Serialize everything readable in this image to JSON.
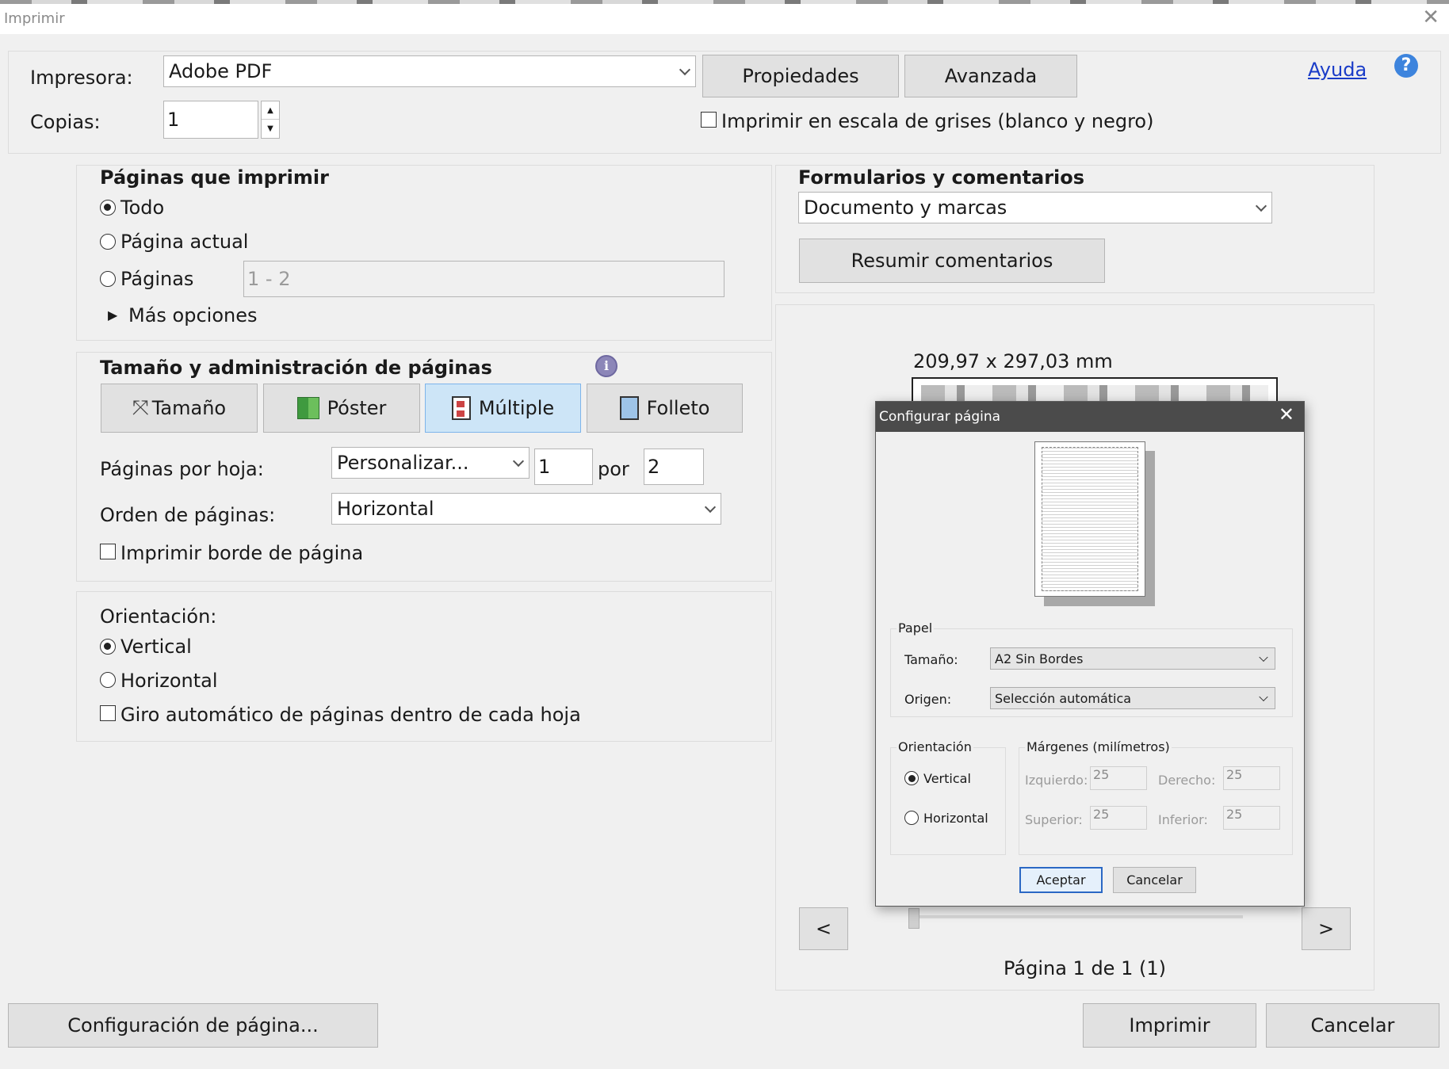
{
  "window": {
    "title": "Imprimir"
  },
  "printer": {
    "label": "Impresora:",
    "value": "Adobe PDF",
    "properties_btn": "Propiedades",
    "advanced_btn": "Avanzada",
    "help_link": "Ayuda",
    "copies_label": "Copias:",
    "copies_value": "1",
    "grayscale_label": "Imprimir en escala de grises (blanco y negro)"
  },
  "pages_to_print": {
    "heading": "Páginas que imprimir",
    "opt_all": "Todo",
    "opt_current": "Página actual",
    "opt_pages": "Páginas",
    "pages_placeholder": "1 - 2",
    "more_options": "Más opciones",
    "selected": "Todo"
  },
  "page_handling": {
    "heading": "Tamaño y administración de páginas",
    "tabs": [
      "Tamaño",
      "Póster",
      "Múltiple",
      "Folleto"
    ],
    "active_tab": "Múltiple",
    "pages_per_sheet_label": "Páginas por hoja:",
    "pages_per_sheet_value": "Personalizar...",
    "cols": "1",
    "by": "por",
    "rows": "2",
    "order_label": "Orden de páginas:",
    "order_value": "Horizontal",
    "border_label": "Imprimir borde de página"
  },
  "orientation": {
    "heading": "Orientación:",
    "vertical": "Vertical",
    "horizontal": "Horizontal",
    "auto_rotate": "Giro automático de páginas dentro de cada hoja",
    "selected": "Vertical"
  },
  "comments": {
    "heading": "Formularios y comentarios",
    "value": "Documento y marcas",
    "summarize_btn": "Resumir comentarios"
  },
  "preview": {
    "dimensions": "209,97 x 297,03 mm",
    "prev": "<",
    "next": ">",
    "page_status": "Página 1 de 1 (1)"
  },
  "footer": {
    "page_setup_btn": "Configuración de página...",
    "print_btn": "Imprimir",
    "cancel_btn": "Cancelar"
  },
  "page_setup_dialog": {
    "title": "Configurar página",
    "paper_group": "Papel",
    "size_label": "Tamaño:",
    "size_value": "A2 Sin Bordes",
    "source_label": "Origen:",
    "source_value": "Selección automática",
    "orientation_group": "Orientación",
    "vertical": "Vertical",
    "horizontal": "Horizontal",
    "margins_group": "Márgenes (milímetros)",
    "left_label": "Izquierdo:",
    "left_value": "25",
    "right_label": "Derecho:",
    "right_value": "25",
    "top_label": "Superior:",
    "top_value": "25",
    "bottom_label": "Inferior:",
    "bottom_value": "25",
    "ok_btn": "Aceptar",
    "cancel_btn": "Cancelar"
  },
  "colors": {
    "accent_blue": "#2b68c4",
    "active_tab": "#cde5f7",
    "dialog_title": "#4b4b4b"
  }
}
